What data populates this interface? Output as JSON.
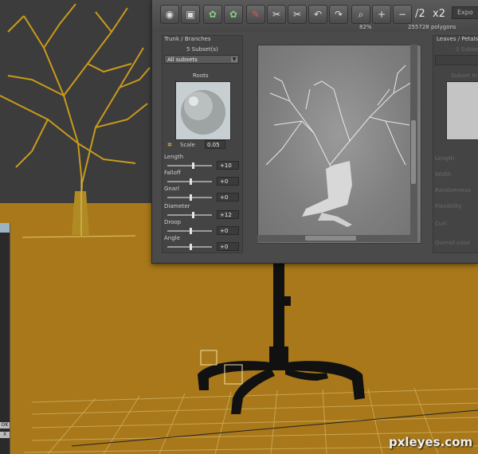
{
  "toolbar": {
    "zoom": "82%",
    "polygons": "255728 polygons",
    "lod_half": "/2",
    "lod_double": "x2",
    "export_label": "Expo"
  },
  "trunk": {
    "header": "Trunk / Branches",
    "subsets_count": "5 Subset(s)",
    "subset_select": "All subsets",
    "material_label": "Roots",
    "scale_label": "Scale",
    "scale_value": "0.05",
    "params": [
      {
        "label": "Length",
        "value": "+10",
        "level": 0.55
      },
      {
        "label": "Falloff",
        "value": "+0",
        "level": 0.5
      },
      {
        "label": "Gnarl",
        "value": "+0",
        "level": 0.5
      },
      {
        "label": "Diameter",
        "value": "+12",
        "level": 0.56
      },
      {
        "label": "Droop",
        "value": "+0",
        "level": 0.5
      },
      {
        "label": "Angle",
        "value": "+0",
        "level": 0.5
      }
    ]
  },
  "leaves": {
    "header": "Leaves / Petals",
    "subsets_count": "0 Subse",
    "material_label": "Subset m",
    "params": [
      "Length",
      "Width",
      "Randomness",
      "Flexibility",
      "Curl",
      "Overall color"
    ]
  },
  "left_window": {
    "ok_label": "OK",
    "x_label": "X"
  },
  "watermark": "pxleyes.com",
  "colors": {
    "ground": "#a8781a",
    "tree_wire": "#c89a1c",
    "panel_bg": "#4a4a4a",
    "viewport_bg": "#8a8a8a"
  }
}
